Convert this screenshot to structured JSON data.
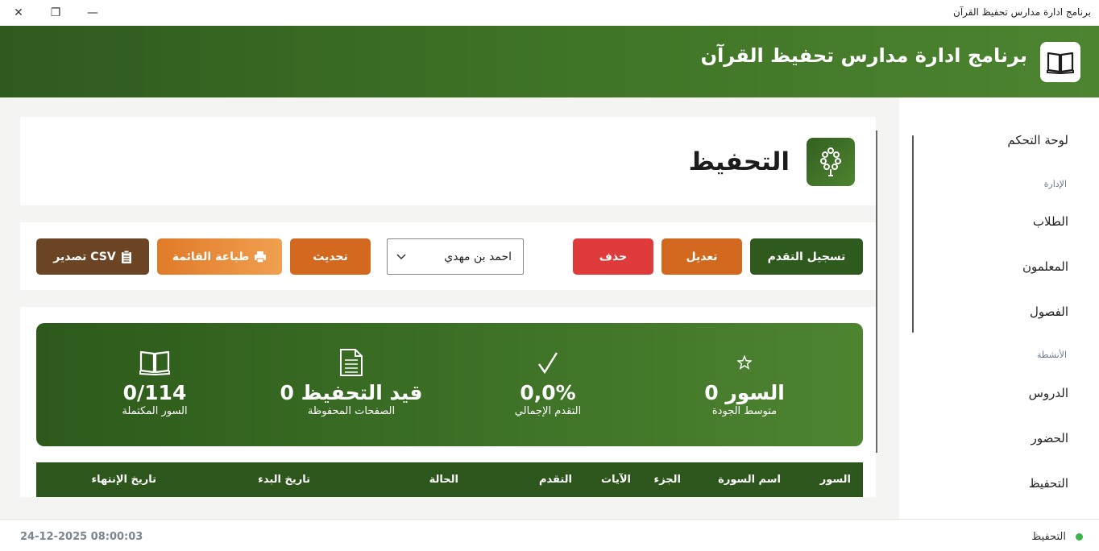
{
  "window": {
    "title": "برنامج ادارة مدارس تحفيظ القرآن",
    "close_glyph": "✕",
    "restore_glyph": "❐",
    "minimize_glyph": "—"
  },
  "header": {
    "title": "برنامج ادارة مدارس تحفيظ القرآن",
    "logo_icon": "open-book-icon",
    "colors": {
      "start": "#2f5a1e",
      "end": "#4c8430"
    }
  },
  "sidebar": {
    "dashboard": "لوحة التحكم",
    "section_admin": "الإدارة",
    "students": "الطلاب",
    "teachers": "المعلمون",
    "classes": "الفصول",
    "section_activities": "الأنشطة",
    "lessons": "الدروس",
    "attendance": "الحضور",
    "memorization": "التحفيظ"
  },
  "page": {
    "title": "التحفيظ",
    "icon": "prayer-beads-icon"
  },
  "toolbar": {
    "record_progress": "تسجيل التقدم",
    "edit": "تعديل",
    "delete": "حذف",
    "student_selected": "احمد بن مهدي",
    "refresh": "تحديث",
    "print_list": "طباعة القائمة",
    "export_csv": "CSV تصدير",
    "colors": {
      "primary": "#2f5a1e",
      "orange": "#d2691e",
      "danger": "#e03b3b",
      "brown": "#6b4423"
    }
  },
  "stats": {
    "quality": {
      "value": "السور 0",
      "label": "متوسط الجودة",
      "icon": "star-icon"
    },
    "overall": {
      "value": "0,0%",
      "label": "التقدم الإجمالي",
      "icon": "checkmark-icon"
    },
    "pages": {
      "value": "قيد التحفيظ 0",
      "label": "الصفحات المحفوظة",
      "icon": "document-icon"
    },
    "surahs": {
      "value": "0/114",
      "label": "السور المكتملة",
      "icon": "book-icon"
    }
  },
  "table": {
    "columns": [
      "السور",
      "اسم السورة",
      "الجزء",
      "الآيات",
      "التقدم",
      "الحالة",
      "تاريخ البدء",
      "تاريخ الإنتهاء"
    ]
  },
  "statusbar": {
    "current": "التحفيظ",
    "datetime": "24-12-2025 08:00:03"
  }
}
